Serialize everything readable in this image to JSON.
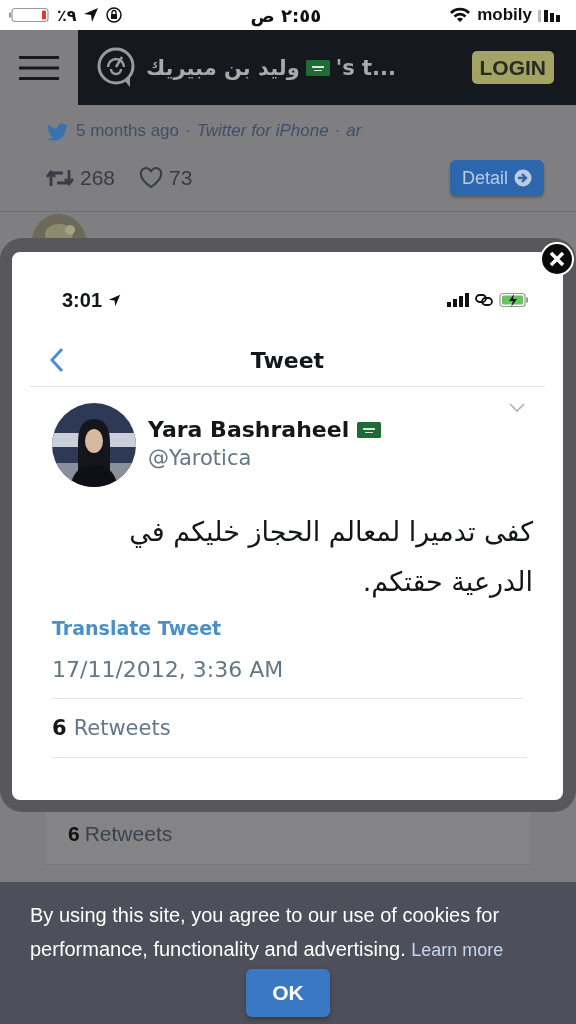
{
  "status_bar": {
    "battery_percent": "٩٪",
    "time": "٢:٥٥ ص",
    "carrier": "mobily"
  },
  "header": {
    "title_name": "وليد بن مبيريك",
    "title_suffix": "'s t...",
    "login_button": "LOGIN"
  },
  "feed_top": {
    "time": "5 months ago",
    "separator_1": "·",
    "source": "Twitter for iPhone",
    "separator_2": "·",
    "lang": "ar",
    "retweets": "268",
    "likes": "73",
    "detail_button": "Detail"
  },
  "embedded_card": {
    "retweets_count": "6",
    "retweets_label": "Retweets"
  },
  "modal": {
    "status_time": "3:01",
    "nav_title": "Tweet",
    "author_name": "Yara Bashraheel",
    "author_handle": "@Yarotica",
    "text": "كفى تدميرا لمعالم الحجاز خليكم في الدرعية حقتكم.",
    "translate_link": "Translate Tweet",
    "timestamp": "17/11/2012, 3:36 AM",
    "retweets_count": "6",
    "retweets_label": "Retweets"
  },
  "cookie_banner": {
    "message": "By using this site, you agree to our use of cookies for performance, functionality and advertising.",
    "link": "Learn more",
    "button": "OK"
  }
}
